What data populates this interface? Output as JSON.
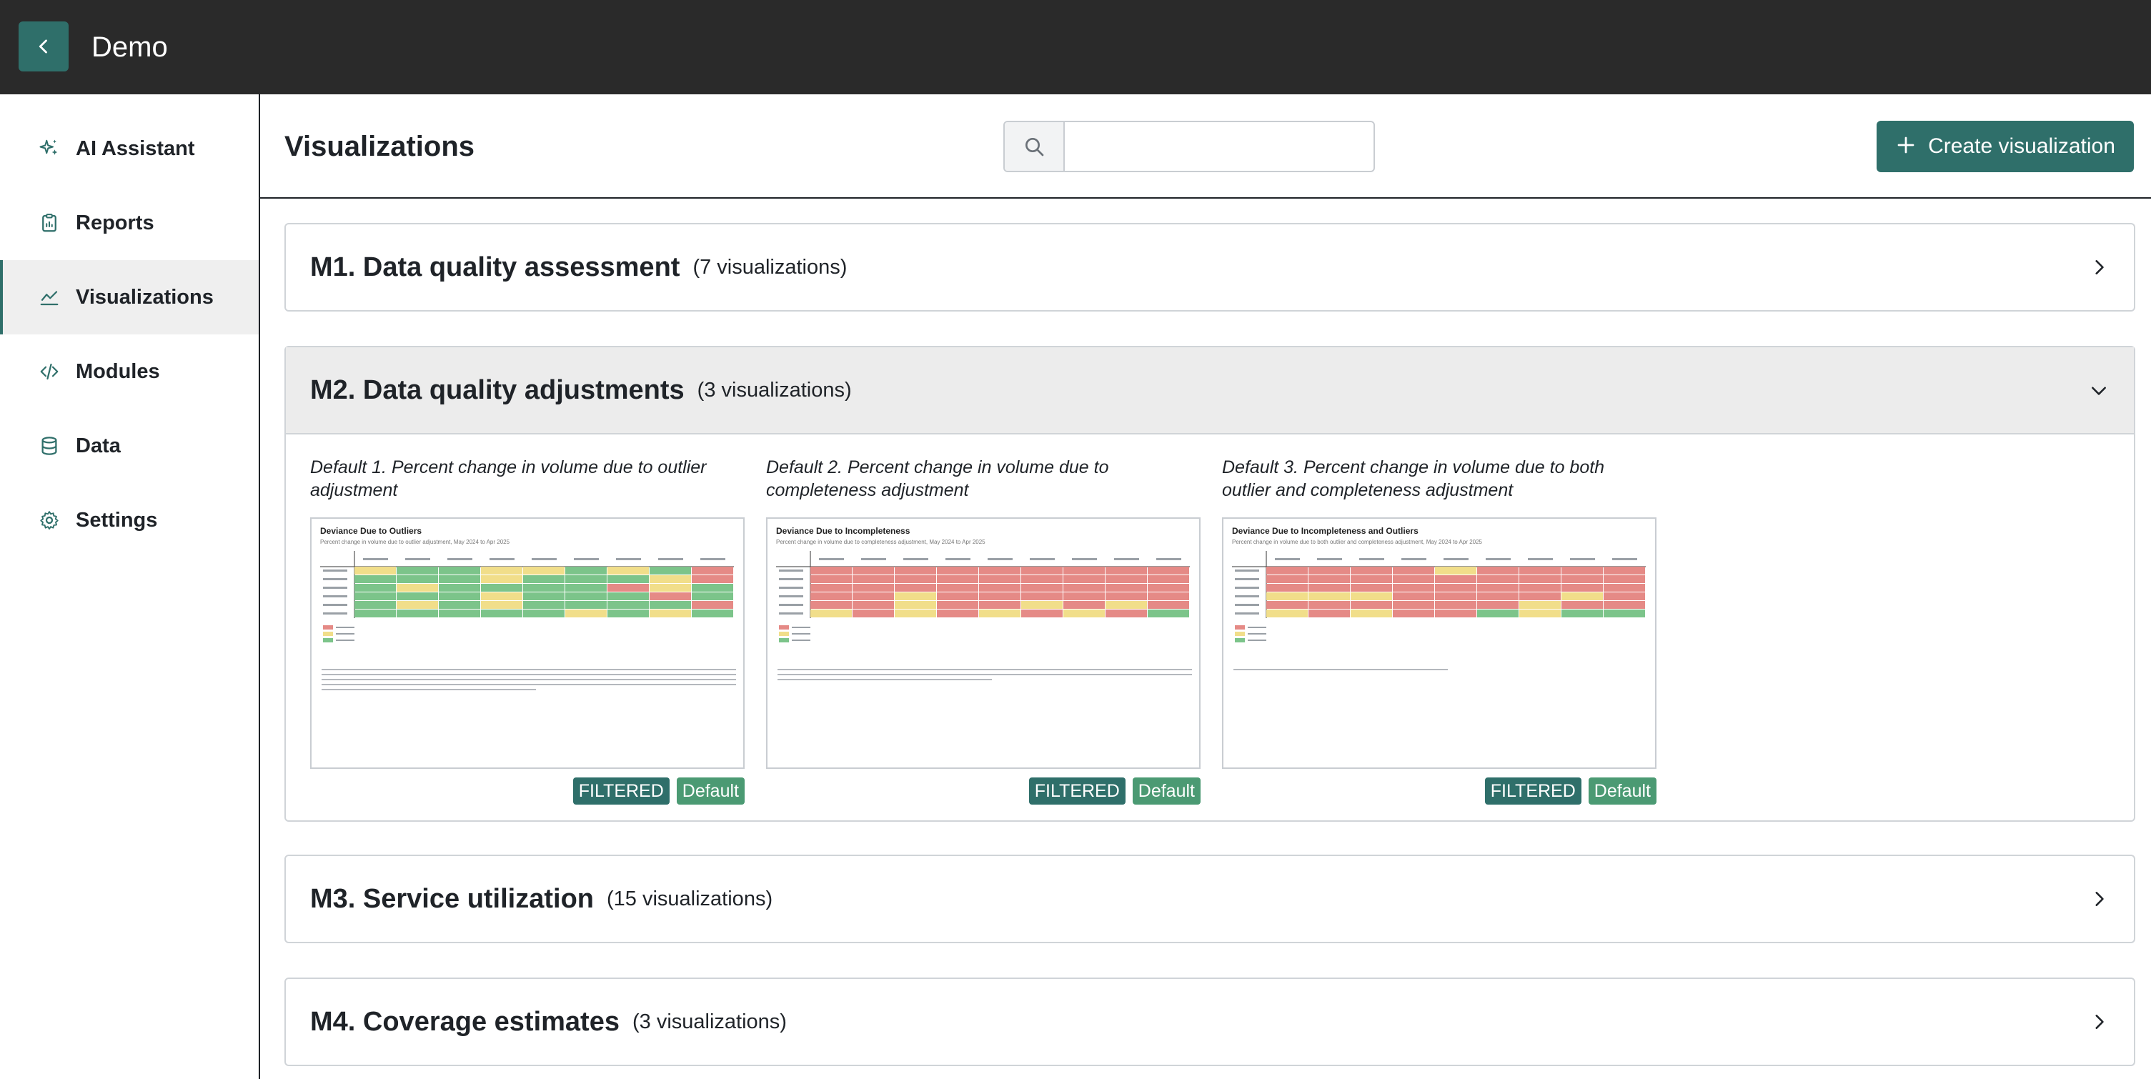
{
  "app": {
    "title": "Demo"
  },
  "sidebar": {
    "items": [
      {
        "label": "AI Assistant",
        "icon": "sparkles-icon",
        "active": false
      },
      {
        "label": "Reports",
        "icon": "clipboard-icon",
        "active": false
      },
      {
        "label": "Visualizations",
        "icon": "line-chart-icon",
        "active": true
      },
      {
        "label": "Modules",
        "icon": "code-icon",
        "active": false
      },
      {
        "label": "Data",
        "icon": "database-icon",
        "active": false
      },
      {
        "label": "Settings",
        "icon": "gear-icon",
        "active": false
      }
    ]
  },
  "header": {
    "title": "Visualizations",
    "search_value": "",
    "create_label": "Create visualization"
  },
  "modules": [
    {
      "title": "M1. Data quality assessment",
      "count": "(7 visualizations)",
      "expanded": false
    },
    {
      "title": "M2. Data quality adjustments",
      "count": "(3 visualizations)",
      "expanded": true,
      "cards": [
        {
          "title": "Default 1. Percent change in volume due to outlier adjustment",
          "thumb_title": "Deviance Due to Outliers",
          "thumb_subtitle": "Percent change in volume due to outlier adjustment, May 2024 to Apr 2025",
          "badges": [
            "FILTERED",
            "Default"
          ]
        },
        {
          "title": "Default 2. Percent change in volume due to completeness adjustment",
          "thumb_title": "Deviance Due to Incompleteness",
          "thumb_subtitle": "Percent change in volume due to completeness adjustment, May 2024 to Apr 2025",
          "badges": [
            "FILTERED",
            "Default"
          ]
        },
        {
          "title": "Default 3. Percent change in volume due to both outlier and completeness adjustment",
          "thumb_title": "Deviance Due to Incompleteness and Outliers",
          "thumb_subtitle": "Percent change in volume due to both outlier and completeness adjustment, May 2024 to Apr 2025",
          "badges": [
            "FILTERED",
            "Default"
          ]
        }
      ]
    },
    {
      "title": "M3. Service utilization",
      "count": "(15 visualizations)",
      "expanded": false
    },
    {
      "title": "M4. Coverage estimates",
      "count": "(3 visualizations)",
      "expanded": false
    }
  ],
  "colors": {
    "accent": "#2f6f6a",
    "default_badge": "#4b9a73",
    "topbar": "#2a2a2a",
    "cell_red": "#e58a86",
    "cell_yellow": "#f1de8a",
    "cell_green": "#7cc48a"
  }
}
